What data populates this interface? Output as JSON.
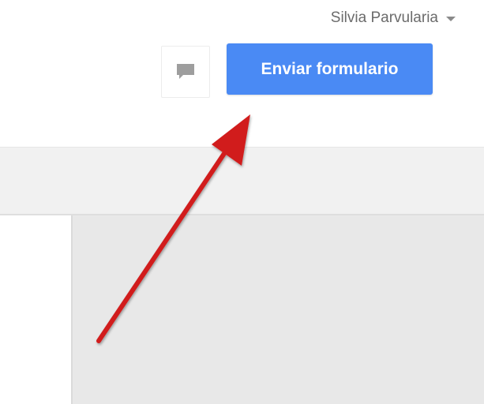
{
  "header": {
    "user_name": "Silvia Parvularia",
    "user_menu_icon": "chevron-down-icon",
    "comment_icon": "comment-icon",
    "send_button_label": "Enviar formulario"
  },
  "colors": {
    "send_button": "#4a8af4",
    "annotation_arrow": "#d11f1f",
    "toolbar_band": "#f1f1f1",
    "canvas": "#e8e8e8"
  }
}
